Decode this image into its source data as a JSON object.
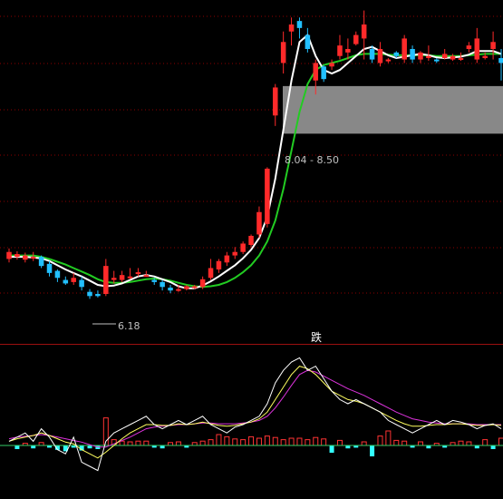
{
  "price_panel": {
    "zone_label": "8.04 - 8.50",
    "low_label": "6.18",
    "colors": {
      "up": "#ff2a2a",
      "down": "#22c0ff",
      "ma_short": "#ffffff",
      "ma_long": "#22cc22",
      "zone": "#888888",
      "grid": "#8b0000"
    }
  },
  "signal": {
    "text": "跌",
    "color": "#ffffff"
  },
  "indicator_panel": {
    "colors": {
      "fast": "#ffffff",
      "mid": "#ffff60",
      "slow": "#dd33dd",
      "bar_up": "#ff3333",
      "bar_down": "#33ffff",
      "zero": "#33cc66"
    }
  },
  "chart_data": {
    "type": "candlestick",
    "price_range": {
      "low_label": 6.18,
      "zone": [
        8.04,
        8.5
      ]
    },
    "candles": [
      {
        "o": 6.85,
        "h": 6.9,
        "l": 6.7,
        "c": 6.75,
        "dir": "up"
      },
      {
        "o": 6.78,
        "h": 6.86,
        "l": 6.74,
        "c": 6.82,
        "dir": "up"
      },
      {
        "o": 6.8,
        "h": 6.84,
        "l": 6.7,
        "c": 6.74,
        "dir": "up"
      },
      {
        "o": 6.78,
        "h": 6.85,
        "l": 6.72,
        "c": 6.76,
        "dir": "up"
      },
      {
        "o": 6.78,
        "h": 6.8,
        "l": 6.62,
        "c": 6.65,
        "dir": "down"
      },
      {
        "o": 6.68,
        "h": 6.72,
        "l": 6.5,
        "c": 6.55,
        "dir": "down"
      },
      {
        "o": 6.58,
        "h": 6.6,
        "l": 6.42,
        "c": 6.48,
        "dir": "down"
      },
      {
        "o": 6.45,
        "h": 6.5,
        "l": 6.38,
        "c": 6.4,
        "dir": "down"
      },
      {
        "o": 6.42,
        "h": 6.55,
        "l": 6.38,
        "c": 6.48,
        "dir": "up"
      },
      {
        "o": 6.45,
        "h": 6.5,
        "l": 6.3,
        "c": 6.35,
        "dir": "down"
      },
      {
        "o": 6.28,
        "h": 6.32,
        "l": 6.18,
        "c": 6.22,
        "dir": "down"
      },
      {
        "o": 6.25,
        "h": 6.3,
        "l": 6.2,
        "c": 6.22,
        "dir": "down"
      },
      {
        "o": 6.25,
        "h": 6.75,
        "l": 6.22,
        "c": 6.65,
        "dir": "up"
      },
      {
        "o": 6.48,
        "h": 6.58,
        "l": 6.4,
        "c": 6.45,
        "dir": "up"
      },
      {
        "o": 6.45,
        "h": 6.58,
        "l": 6.42,
        "c": 6.52,
        "dir": "up"
      },
      {
        "o": 6.5,
        "h": 6.62,
        "l": 6.46,
        "c": 6.5,
        "dir": "up"
      },
      {
        "o": 6.54,
        "h": 6.62,
        "l": 6.5,
        "c": 6.56,
        "dir": "up"
      },
      {
        "o": 6.52,
        "h": 6.58,
        "l": 6.5,
        "c": 6.52,
        "dir": "up"
      },
      {
        "o": 6.45,
        "h": 6.48,
        "l": 6.38,
        "c": 6.42,
        "dir": "down"
      },
      {
        "o": 6.42,
        "h": 6.45,
        "l": 6.3,
        "c": 6.35,
        "dir": "down"
      },
      {
        "o": 6.34,
        "h": 6.38,
        "l": 6.26,
        "c": 6.3,
        "dir": "down"
      },
      {
        "o": 6.3,
        "h": 6.38,
        "l": 6.28,
        "c": 6.32,
        "dir": "up"
      },
      {
        "o": 6.32,
        "h": 6.38,
        "l": 6.3,
        "c": 6.36,
        "dir": "up"
      },
      {
        "o": 6.36,
        "h": 6.38,
        "l": 6.32,
        "c": 6.34,
        "dir": "up"
      },
      {
        "o": 6.35,
        "h": 6.5,
        "l": 6.32,
        "c": 6.46,
        "dir": "up"
      },
      {
        "o": 6.48,
        "h": 6.75,
        "l": 6.45,
        "c": 6.62,
        "dir": "up"
      },
      {
        "o": 6.6,
        "h": 6.75,
        "l": 6.55,
        "c": 6.72,
        "dir": "up"
      },
      {
        "o": 6.7,
        "h": 6.85,
        "l": 6.65,
        "c": 6.8,
        "dir": "up"
      },
      {
        "o": 6.8,
        "h": 6.92,
        "l": 6.75,
        "c": 6.85,
        "dir": "up"
      },
      {
        "o": 6.85,
        "h": 7.0,
        "l": 6.82,
        "c": 6.97,
        "dir": "up"
      },
      {
        "o": 6.95,
        "h": 7.1,
        "l": 6.92,
        "c": 7.08,
        "dir": "up"
      },
      {
        "o": 7.1,
        "h": 7.5,
        "l": 7.05,
        "c": 7.42,
        "dir": "up"
      },
      {
        "o": 7.25,
        "h": 8.06,
        "l": 7.2,
        "c": 8.04,
        "dir": "up"
      },
      {
        "o": 8.8,
        "h": 9.25,
        "l": 8.65,
        "c": 9.2,
        "dir": "up"
      },
      {
        "o": 9.55,
        "h": 10.0,
        "l": 9.4,
        "c": 9.85,
        "dir": "up"
      },
      {
        "o": 10.0,
        "h": 10.2,
        "l": 9.8,
        "c": 10.1,
        "dir": "up"
      },
      {
        "o": 10.05,
        "h": 10.2,
        "l": 9.9,
        "c": 10.15,
        "dir": "down"
      },
      {
        "o": 9.95,
        "h": 10.05,
        "l": 9.7,
        "c": 9.75,
        "dir": "down"
      },
      {
        "o": 9.55,
        "h": 9.6,
        "l": 9.1,
        "c": 9.3,
        "dir": "up"
      },
      {
        "o": 9.5,
        "h": 9.52,
        "l": 9.28,
        "c": 9.32,
        "dir": "down"
      },
      {
        "o": 9.5,
        "h": 9.6,
        "l": 9.45,
        "c": 9.55,
        "dir": "up"
      },
      {
        "o": 9.65,
        "h": 9.95,
        "l": 9.6,
        "c": 9.8,
        "dir": "up"
      },
      {
        "o": 9.7,
        "h": 9.9,
        "l": 9.6,
        "c": 9.75,
        "dir": "up"
      },
      {
        "o": 9.82,
        "h": 10.0,
        "l": 9.8,
        "c": 9.95,
        "dir": "up"
      },
      {
        "o": 9.9,
        "h": 10.3,
        "l": 9.6,
        "c": 10.1,
        "dir": "up"
      },
      {
        "o": 9.75,
        "h": 9.8,
        "l": 9.55,
        "c": 9.6,
        "dir": "down"
      },
      {
        "o": 9.75,
        "h": 9.85,
        "l": 9.5,
        "c": 9.55,
        "dir": "up"
      },
      {
        "o": 9.6,
        "h": 9.62,
        "l": 9.55,
        "c": 9.58,
        "dir": "up"
      },
      {
        "o": 9.7,
        "h": 9.72,
        "l": 9.62,
        "c": 9.65,
        "dir": "down"
      },
      {
        "o": 9.6,
        "h": 9.95,
        "l": 9.55,
        "c": 9.9,
        "dir": "up"
      },
      {
        "o": 9.75,
        "h": 9.8,
        "l": 9.55,
        "c": 9.6,
        "dir": "down"
      },
      {
        "o": 9.7,
        "h": 9.72,
        "l": 9.55,
        "c": 9.6,
        "dir": "up"
      },
      {
        "o": 9.62,
        "h": 9.8,
        "l": 9.58,
        "c": 9.65,
        "dir": "up"
      },
      {
        "o": 9.6,
        "h": 9.62,
        "l": 9.55,
        "c": 9.58,
        "dir": "down"
      },
      {
        "o": 9.68,
        "h": 9.75,
        "l": 9.6,
        "c": 9.62,
        "dir": "up"
      },
      {
        "o": 9.6,
        "h": 9.68,
        "l": 9.58,
        "c": 9.65,
        "dir": "up"
      },
      {
        "o": 9.62,
        "h": 9.7,
        "l": 9.58,
        "c": 9.62,
        "dir": "up"
      },
      {
        "o": 9.8,
        "h": 9.85,
        "l": 9.7,
        "c": 9.75,
        "dir": "up"
      },
      {
        "o": 9.6,
        "h": 10.05,
        "l": 9.55,
        "c": 9.9,
        "dir": "up"
      },
      {
        "o": 9.65,
        "h": 9.7,
        "l": 9.6,
        "c": 9.62,
        "dir": "up"
      },
      {
        "o": 9.75,
        "h": 10.0,
        "l": 9.6,
        "c": 9.85,
        "dir": "up"
      },
      {
        "o": 9.62,
        "h": 9.75,
        "l": 9.3,
        "c": 9.55,
        "dir": "down"
      }
    ],
    "ma_short": [
      6.78,
      6.78,
      6.78,
      6.77,
      6.76,
      6.72,
      6.66,
      6.6,
      6.55,
      6.5,
      6.44,
      6.38,
      6.36,
      6.37,
      6.4,
      6.45,
      6.5,
      6.52,
      6.5,
      6.46,
      6.42,
      6.36,
      6.33,
      6.33,
      6.37,
      6.43,
      6.5,
      6.58,
      6.66,
      6.76,
      6.88,
      7.05,
      7.35,
      7.9,
      8.6,
      9.3,
      9.85,
      9.95,
      9.65,
      9.45,
      9.4,
      9.45,
      9.55,
      9.65,
      9.75,
      9.78,
      9.72,
      9.66,
      9.62,
      9.64,
      9.66,
      9.68,
      9.66,
      9.63,
      9.62,
      9.63,
      9.64,
      9.67,
      9.72,
      9.72,
      9.72,
      9.68
    ],
    "ma_long": [
      6.8,
      6.8,
      6.8,
      6.8,
      6.78,
      6.75,
      6.71,
      6.67,
      6.62,
      6.57,
      6.52,
      6.46,
      6.42,
      6.41,
      6.41,
      6.42,
      6.44,
      6.46,
      6.47,
      6.46,
      6.44,
      6.41,
      6.38,
      6.36,
      6.35,
      6.36,
      6.38,
      6.42,
      6.48,
      6.56,
      6.66,
      6.8,
      7.0,
      7.3,
      7.75,
      8.3,
      8.85,
      9.25,
      9.45,
      9.52,
      9.55,
      9.58,
      9.62,
      9.66,
      9.68,
      9.68,
      9.68,
      9.67,
      9.66,
      9.66,
      9.66,
      9.66,
      9.66,
      9.65,
      9.65,
      9.65,
      9.65,
      9.66,
      9.67,
      9.68,
      9.68,
      9.68
    ],
    "indicator": {
      "fast": [
        0.5,
        1,
        1.5,
        0.5,
        2,
        1,
        -0.5,
        -1,
        1,
        -2,
        -2.5,
        -3,
        0.5,
        1.5,
        2,
        2.5,
        3,
        3.5,
        2.5,
        2,
        2.5,
        3,
        2.5,
        3,
        3.5,
        2.5,
        2,
        1.5,
        2.2,
        2.5,
        3,
        3.5,
        5,
        7.5,
        9,
        10,
        10.5,
        9,
        9.5,
        8,
        6.5,
        5.5,
        5,
        5.5,
        5,
        4.5,
        4,
        3,
        2.5,
        2,
        1.5,
        2,
        2.5,
        3,
        2.5,
        3,
        2.8,
        2.5,
        2,
        2.4,
        2.6,
        2
      ],
      "mid": [
        0.5,
        0.8,
        1,
        1.2,
        1.5,
        1.2,
        0.8,
        0.4,
        0.2,
        -0.5,
        -1,
        -1.5,
        -0.8,
        0,
        0.8,
        1.5,
        2,
        2.5,
        2.5,
        2.4,
        2.4,
        2.6,
        2.5,
        2.6,
        2.8,
        2.6,
        2.4,
        2.3,
        2.4,
        2.6,
        2.8,
        3.2,
        4,
        5.5,
        7,
        8.5,
        9.5,
        9.2,
        8.5,
        7.5,
        6.5,
        6,
        5.5,
        5.3,
        5,
        4.5,
        4,
        3.5,
        3,
        2.6,
        2.3,
        2.3,
        2.4,
        2.5,
        2.5,
        2.6,
        2.6,
        2.5,
        2.4,
        2.4,
        2.5,
        2.4
      ],
      "slow": [
        0.8,
        1,
        1.1,
        1.2,
        1.3,
        1.2,
        1,
        0.8,
        0.6,
        0.4,
        0.1,
        -0.2,
        -0.2,
        0.2,
        0.6,
        1,
        1.5,
        2,
        2.2,
        2.3,
        2.4,
        2.5,
        2.5,
        2.6,
        2.7,
        2.7,
        2.6,
        2.6,
        2.6,
        2.7,
        2.8,
        3,
        3.5,
        4.5,
        5.8,
        7.2,
        8.5,
        9,
        8.8,
        8.3,
        7.8,
        7.3,
        6.8,
        6.4,
        6,
        5.5,
        5,
        4.5,
        4,
        3.6,
        3.2,
        3,
        2.8,
        2.7,
        2.6,
        2.6,
        2.6,
        2.6,
        2.5,
        2.5,
        2.5,
        2.5
      ],
      "bars": [
        0,
        -0.5,
        0.3,
        -0.4,
        0.4,
        -0.3,
        -0.6,
        -0.8,
        -0.3,
        -0.7,
        -0.4,
        -0.5,
        3.8,
        0.8,
        0.6,
        0.5,
        0.6,
        0.6,
        -0.3,
        -0.4,
        0.4,
        0.5,
        -0.3,
        0.4,
        0.6,
        0.8,
        1.5,
        1.2,
        0.9,
        0.8,
        1.2,
        1,
        1.3,
        1.1,
        0.8,
        1,
        1,
        0.8,
        1.1,
        0.9,
        -1,
        0.7,
        -0.4,
        -0.3,
        0.5,
        -1.5,
        1.3,
        2,
        0.7,
        0.6,
        -0.3,
        0.5,
        -0.4,
        0.3,
        -0.3,
        0.4,
        0.6,
        0.5,
        -0.4,
        0.8,
        -0.5,
        1
      ]
    }
  }
}
